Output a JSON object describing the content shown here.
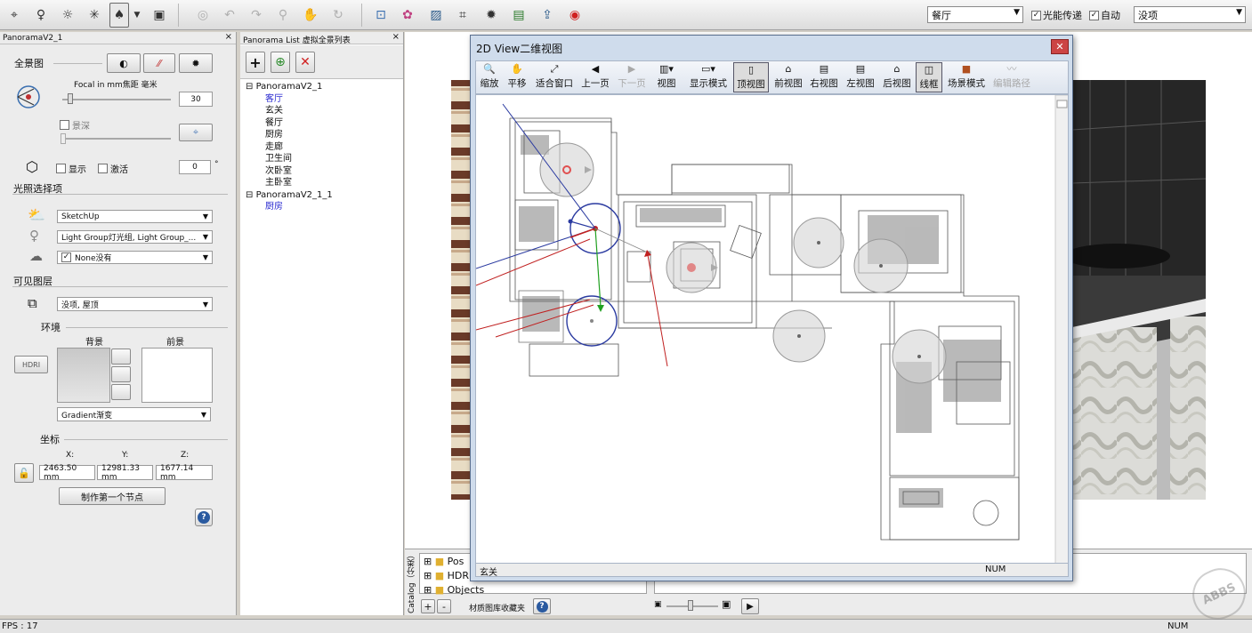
{
  "toolbar": {
    "left_icons": [
      "camera-tool-icon",
      "light-bulb-icon",
      "sun-icon",
      "star-light-icon",
      "panorama-node-icon",
      "dropdown-arrow-icon",
      "document-icon"
    ],
    "mid_icons": [
      "render-icon",
      "undo-icon",
      "redo-icon",
      "zoom-icon",
      "pan-hand-icon",
      "rotate-icon"
    ],
    "right_icons": [
      "import-icon",
      "palette-icon",
      "picture-icon",
      "crop-icon",
      "settings-gear-icon",
      "screen-icon",
      "export-icon",
      "logo-icon"
    ],
    "scene_select": "餐厅",
    "light_transfer_label": "光能传递",
    "auto_label": "自动",
    "layer_select": "没项"
  },
  "left_panel": {
    "title": "PanoramaV2_1",
    "panorama_label": "全景图",
    "focal_label": "Focal in mm焦距 毫米",
    "focal_value": "30",
    "depth_label": "景深",
    "show_label": "显示",
    "activate_label": "激活",
    "angle_value": "0",
    "angle_unit": "°",
    "light_section": "光照选择项",
    "sun_select": "SketchUp",
    "light_group_select": "Light Group灯光组, Light Group_...",
    "none_select": "None没有",
    "layers_section": "可见图层",
    "layers_select": "没项, 屋顶",
    "env_section": "环境",
    "background_label": "背景",
    "foreground_label": "前景",
    "hdri_label": "HDRI",
    "gradient_select": "Gradient渐变",
    "coords_section": "坐标",
    "x_label": "X:",
    "y_label": "Y:",
    "z_label": "Z:",
    "x_value": "2463.50 mm",
    "y_value": "12981.33 mm",
    "z_value": "1677.14 mm",
    "make_first_node": "制作第一个节点",
    "help_label": "?"
  },
  "mid_panel": {
    "title": "Panorama List 虚拟全景列表",
    "tree": [
      {
        "label": "PanoramaV2_1",
        "children": [
          "客厅",
          "玄关",
          "餐厅",
          "厨房",
          "走廊",
          "卫生间",
          "次卧室",
          "主卧室"
        ]
      },
      {
        "label": "PanoramaV2_1_1",
        "children": [
          "厨房"
        ]
      }
    ]
  },
  "dialog": {
    "title": "2D View二维视图",
    "close": "✕",
    "tools": [
      {
        "label": "缩放",
        "icon": "🔍",
        "state": "normal"
      },
      {
        "label": "平移",
        "icon": "✋",
        "state": "normal"
      },
      {
        "label": "适合窗口",
        "icon": "⤢",
        "state": "normal"
      },
      {
        "label": "上一页",
        "icon": "◀",
        "state": "normal"
      },
      {
        "label": "下一页",
        "icon": "▶",
        "state": "dim"
      },
      {
        "label": "视图",
        "icon": "▥▾",
        "state": "normal"
      },
      {
        "label": "显示模式",
        "icon": "▭▾",
        "state": "normal"
      },
      {
        "label": "顶视图",
        "icon": "▯",
        "state": "active"
      },
      {
        "label": "前视图",
        "icon": "⌂",
        "state": "normal"
      },
      {
        "label": "右视图",
        "icon": "▤",
        "state": "normal"
      },
      {
        "label": "左视图",
        "icon": "▤",
        "state": "normal"
      },
      {
        "label": "后视图",
        "icon": "⌂",
        "state": "normal"
      },
      {
        "label": "线框",
        "icon": "◫",
        "state": "active"
      },
      {
        "label": "场景模式",
        "icon": "■",
        "state": "normal"
      },
      {
        "label": "编辑路径",
        "icon": "〰",
        "state": "dim"
      }
    ],
    "status_left": "玄关",
    "status_right": "NUM"
  },
  "catalog": {
    "vertical_label": "Catalog（分类）",
    "items": [
      "Pos",
      "HDR",
      "Objects"
    ],
    "favorites_label": "材质图库收藏夹"
  },
  "status": {
    "fps": "FPS : 17",
    "num": "NUM",
    "watermark": "ABBS"
  }
}
